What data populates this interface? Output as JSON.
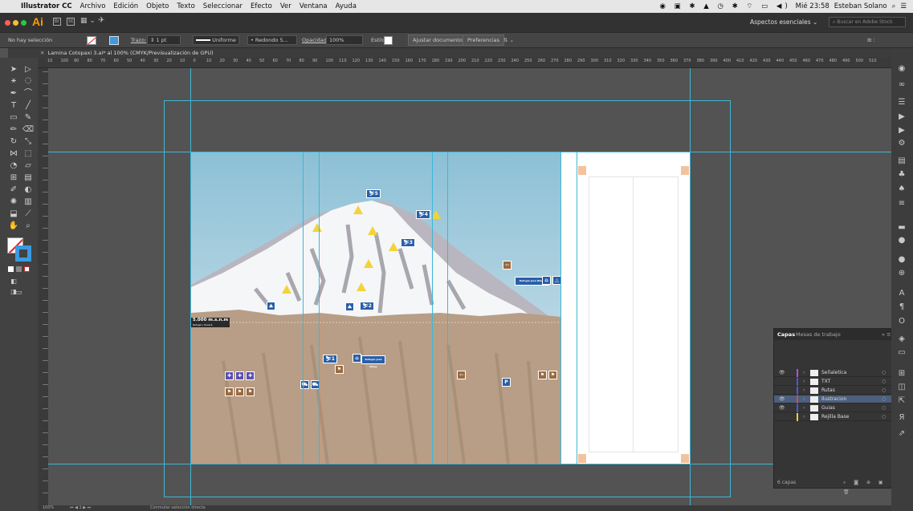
{
  "menubar": {
    "apple": "",
    "app_name": "Illustrator CC",
    "items": [
      "Archivo",
      "Edición",
      "Objeto",
      "Texto",
      "Seleccionar",
      "Efecto",
      "Ver",
      "Ventana",
      "Ayuda"
    ],
    "clock": "Mié 23:58",
    "user": "Esteban Solano"
  },
  "appbar": {
    "logo": "Ai",
    "workspace": "Aspectos esenciales",
    "stock_search_placeholder": "Buscar en Adobe Stock"
  },
  "control": {
    "selection": "No hay selección",
    "stroke_label": "Trazo:",
    "stroke_value": "1 pt",
    "profile": "Uniforme",
    "brush": "Redondo 5...",
    "opacity_label": "Opacidad:",
    "opacity_value": "100%",
    "style_label": "Estilo:",
    "align_doc": "Ajustar documento",
    "prefs": "Preferencias"
  },
  "document_tab": "Lamina Cotopaxi 3.ai* al 100% (CMYK/Previsualización de GPU)",
  "ruler_h": [
    "10",
    "100",
    "90",
    "80",
    "70",
    "60",
    "50",
    "40",
    "30",
    "20",
    "10",
    "0",
    "10",
    "20",
    "30",
    "40",
    "50",
    "60",
    "70",
    "80",
    "90",
    "100",
    "110",
    "120",
    "130",
    "140",
    "150",
    "160",
    "170",
    "180",
    "190",
    "200",
    "210",
    "220",
    "230",
    "240",
    "250",
    "260",
    "270",
    "280",
    "290",
    "300",
    "310",
    "320",
    "330",
    "340",
    "350",
    "360",
    "370",
    "380",
    "390",
    "400",
    "410",
    "420",
    "430",
    "440",
    "450",
    "460",
    "470",
    "480",
    "490",
    "500",
    "510"
  ],
  "artwork": {
    "altitude_label": "5.000 m.s.n.m",
    "altitude_sub": "Refugio / Pucará",
    "signs": [
      "5",
      "4",
      "3",
      "2",
      "1"
    ],
    "refuge_label_1": "Refugio José Ribas",
    "refuge_label_2": "Refugio José Ribas"
  },
  "layers_panel": {
    "tab_layers": "Capas",
    "tab_artboards": "Mesas de trabajo",
    "layers": [
      {
        "name": "Señaletica",
        "color": "#b94fd1",
        "visible": true
      },
      {
        "name": "TXT",
        "color": "#4a56e0",
        "visible": false
      },
      {
        "name": "Rutas",
        "color": "#4a56e0",
        "visible": false
      },
      {
        "name": "Ilustracion",
        "color": "#d14f4f",
        "visible": true
      },
      {
        "name": "Guias",
        "color": "#4a56e0",
        "visible": true
      },
      {
        "name": "Rejilla Base",
        "color": "#e6d13a",
        "visible": false
      }
    ],
    "footer": "6 capas"
  },
  "status": {
    "zoom": "100%",
    "page": "1",
    "tool": "Conmutar selección directa"
  }
}
